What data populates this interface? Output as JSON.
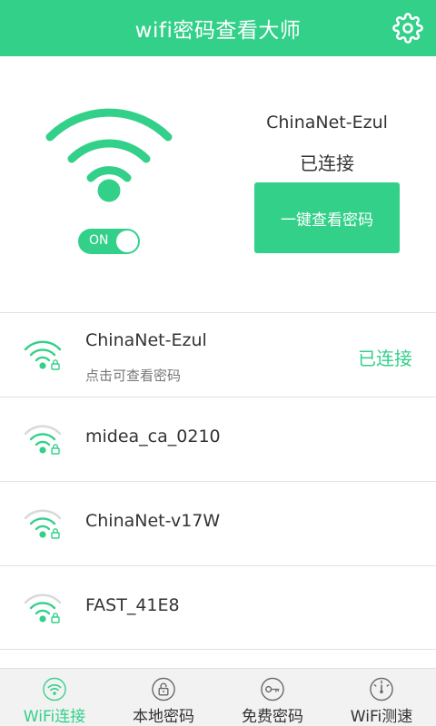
{
  "header": {
    "title": "wifi密码查看大师",
    "settings_icon": "gear-icon"
  },
  "hero": {
    "ssid": "ChinaNet-Ezul",
    "status": "已连接",
    "toggle_label": "ON",
    "toggle_on": true,
    "button_label": "一键查看密码"
  },
  "networks": [
    {
      "ssid": "ChinaNet-Ezul",
      "subtitle": "点击可查看密码",
      "status": "已连接",
      "connected": true,
      "locked": true
    },
    {
      "ssid": "midea_ca_0210",
      "subtitle": "",
      "status": "",
      "connected": false,
      "locked": true
    },
    {
      "ssid": "ChinaNet-v17W",
      "subtitle": "",
      "status": "",
      "connected": false,
      "locked": true
    },
    {
      "ssid": "FAST_41E8",
      "subtitle": "",
      "status": "",
      "connected": false,
      "locked": true
    }
  ],
  "bottom_nav": {
    "items": [
      {
        "label": "WiFi连接",
        "icon": "wifi-icon",
        "active": true
      },
      {
        "label": "本地密码",
        "icon": "lock-icon",
        "active": false
      },
      {
        "label": "免费密码",
        "icon": "key-icon",
        "active": false
      },
      {
        "label": "WiFi测速",
        "icon": "speedometer-icon",
        "active": false
      }
    ]
  },
  "colors": {
    "accent": "#33d089",
    "text": "#333333",
    "subtext": "#777777",
    "divider": "#e2e2e2",
    "nav_bg": "#f2f2f2"
  }
}
